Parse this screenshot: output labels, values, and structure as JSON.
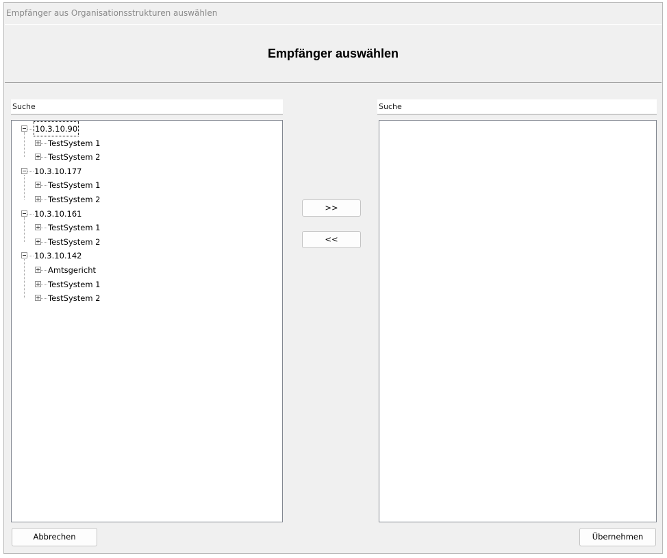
{
  "window": {
    "title": "Empfänger aus Organisationsstrukturen auswählen"
  },
  "header": {
    "title": "Empfänger auswählen"
  },
  "left_panel": {
    "search_placeholder": "Suche",
    "tree": [
      {
        "label": "10.3.10.90",
        "expanded": true,
        "focused": true,
        "children": [
          {
            "label": "TestSystem 1"
          },
          {
            "label": "TestSystem 2"
          }
        ]
      },
      {
        "label": "10.3.10.177",
        "expanded": true,
        "children": [
          {
            "label": "TestSystem 1"
          },
          {
            "label": "TestSystem 2"
          }
        ]
      },
      {
        "label": "10.3.10.161",
        "expanded": true,
        "children": [
          {
            "label": "TestSystem 1"
          },
          {
            "label": "TestSystem 2"
          }
        ]
      },
      {
        "label": "10.3.10.142",
        "expanded": true,
        "children": [
          {
            "label": "Amtsgericht"
          },
          {
            "label": "TestSystem 1"
          },
          {
            "label": "TestSystem 2"
          }
        ]
      }
    ]
  },
  "right_panel": {
    "search_placeholder": "Suche",
    "items": []
  },
  "buttons": {
    "add": ">>",
    "remove": "<<",
    "cancel": "Abbrechen",
    "ok": "Übernehmen"
  },
  "icons": {
    "expanded": "minus-box-icon",
    "collapsed": "plus-box-icon"
  }
}
